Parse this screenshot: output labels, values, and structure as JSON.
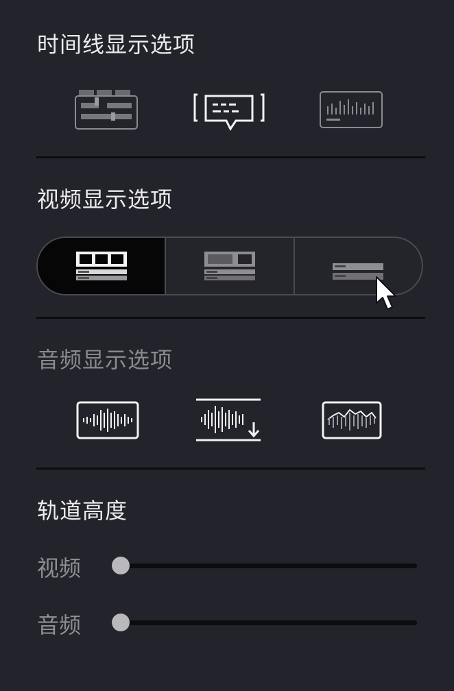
{
  "timeline_display": {
    "title": "时间线显示选项",
    "options": [
      {
        "icon": "clip-names-icon"
      },
      {
        "icon": "clip-captions-icon"
      },
      {
        "icon": "audio-waveform-timeline-icon"
      }
    ]
  },
  "video_display": {
    "title": "视频显示选项",
    "selected_index": 0,
    "options": [
      {
        "icon": "filmstrip-full-icon"
      },
      {
        "icon": "filmstrip-thumbnail-icon"
      },
      {
        "icon": "filmstrip-name-only-icon"
      }
    ]
  },
  "audio_display": {
    "title": "音频显示选项",
    "options": [
      {
        "icon": "waveform-icon"
      },
      {
        "icon": "waveform-reference-icon"
      },
      {
        "icon": "waveform-echo-icon"
      }
    ]
  },
  "track_height": {
    "title": "轨道高度",
    "video_label": "视频",
    "audio_label": "音频",
    "video_value": 0,
    "audio_value": 0
  },
  "colors": {
    "background": "#23232b",
    "selected_segment": "#060607",
    "divider": "#0c0c0f",
    "thumb": "#b9b9bd"
  }
}
